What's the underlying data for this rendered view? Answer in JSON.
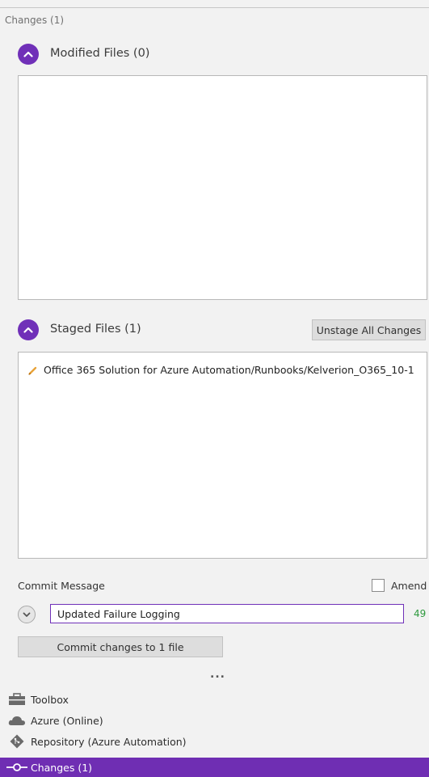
{
  "header": {
    "title": "Changes (1)"
  },
  "modified": {
    "title": "Modified Files (0)",
    "files": []
  },
  "staged": {
    "title": "Staged Files (1)",
    "unstage_label": "Unstage All Changes",
    "files": [
      {
        "icon": "pencil-icon",
        "path": "Office 365 Solution for Azure Automation/Runbooks/Kelverion_O365_10-1"
      }
    ]
  },
  "commit": {
    "label": "Commit Message",
    "amend_label": "Amend",
    "amend_checked": false,
    "message": "Updated Failure Logging",
    "remaining_chars": "49",
    "button_label": "Commit changes to 1 file"
  },
  "overflow": "...",
  "nav": {
    "items": [
      {
        "label": "Toolbox",
        "icon": "toolbox-icon",
        "active": false
      },
      {
        "label": "Azure (Online)",
        "icon": "cloud-icon",
        "active": false
      },
      {
        "label": "Repository (Azure Automation)",
        "icon": "git-icon",
        "active": false
      },
      {
        "label": "Changes (1)",
        "icon": "commit-icon",
        "active": true
      }
    ]
  },
  "colors": {
    "accent": "#7030b8",
    "active_nav": "#6f2eb3",
    "count_green": "#2e9a3e",
    "panel_bg": "#f2f2f2"
  }
}
